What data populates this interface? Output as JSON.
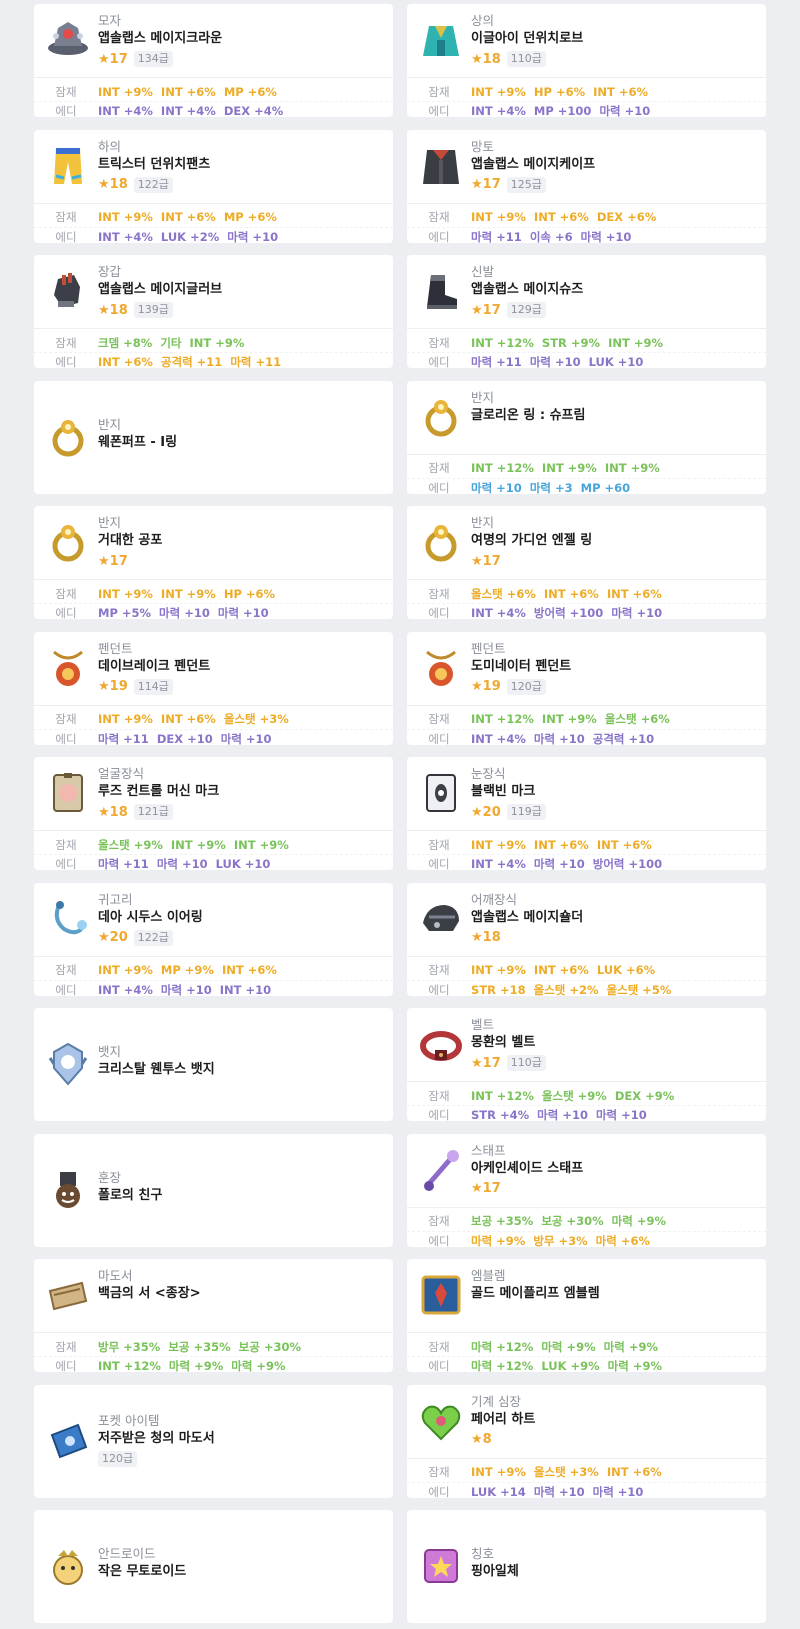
{
  "labels": {
    "potential": "잠재",
    "additional": "에디"
  },
  "colors": {
    "legendary": "#7ac25a",
    "unique": "#eeab26",
    "epic": "#8a74c9",
    "rare": "#48a5db",
    "star": "#f0a830",
    "background": "#eceef2"
  },
  "items": [
    {
      "slot": "모자",
      "name": "앱솔랩스 메이지크라운",
      "stars": "★17",
      "grade": "134급",
      "icon": "hat-icon",
      "pot": {
        "tier": "unique",
        "opts": [
          "INT +9%",
          "INT +6%",
          "MP +6%"
        ]
      },
      "add": {
        "tier": "epic",
        "opts": [
          "INT +4%",
          "INT +4%",
          "DEX +4%"
        ]
      }
    },
    {
      "slot": "상의",
      "name": "이글아이 던위치로브",
      "stars": "★18",
      "grade": "110급",
      "icon": "robe-icon",
      "pot": {
        "tier": "unique",
        "opts": [
          "INT +9%",
          "HP +6%",
          "INT +6%"
        ]
      },
      "add": {
        "tier": "epic",
        "opts": [
          "INT +4%",
          "MP +100",
          "마력 +10"
        ]
      }
    },
    {
      "slot": "하의",
      "name": "트릭스터 던위치팬츠",
      "stars": "★18",
      "grade": "122급",
      "icon": "pants-icon",
      "pot": {
        "tier": "unique",
        "opts": [
          "INT +9%",
          "INT +6%",
          "MP +6%"
        ]
      },
      "add": {
        "tier": "epic",
        "opts": [
          "INT +4%",
          "LUK +2%",
          "마력 +10"
        ]
      }
    },
    {
      "slot": "망토",
      "name": "앱솔랩스 메이지케이프",
      "stars": "★17",
      "grade": "125급",
      "icon": "cape-icon",
      "pot": {
        "tier": "unique",
        "opts": [
          "INT +9%",
          "INT +6%",
          "DEX +6%"
        ]
      },
      "add": {
        "tier": "epic",
        "opts": [
          "마력 +11",
          "이속 +6",
          "마력 +10"
        ]
      }
    },
    {
      "slot": "장갑",
      "name": "앱솔랩스 메이지글러브",
      "stars": "★18",
      "grade": "139급",
      "icon": "glove-icon",
      "pot": {
        "tier": "legendary",
        "opts": [
          "크뎀 +8%",
          "기타",
          "INT +9%"
        ]
      },
      "add": {
        "tier": "unique",
        "opts": [
          "INT +6%",
          "공격력 +11",
          "마력 +11"
        ]
      }
    },
    {
      "slot": "신발",
      "name": "앱솔랩스 메이지슈즈",
      "stars": "★17",
      "grade": "129급",
      "icon": "shoes-icon",
      "pot": {
        "tier": "legendary",
        "opts": [
          "INT +12%",
          "STR +9%",
          "INT +9%"
        ]
      },
      "add": {
        "tier": "epic",
        "opts": [
          "마력 +11",
          "마력 +10",
          "LUK +10"
        ]
      }
    },
    {
      "slot": "반지",
      "name": "웨폰퍼프 - I링",
      "stars": "",
      "grade": "",
      "icon": "ring-icon",
      "pot": null,
      "add": null
    },
    {
      "slot": "반지",
      "name": "글로리온 링 : 슈프림",
      "stars": "",
      "grade": "",
      "icon": "ring-icon",
      "pot": {
        "tier": "legendary",
        "opts": [
          "INT +12%",
          "INT +9%",
          "INT +9%"
        ]
      },
      "add": {
        "tier": "rare",
        "opts": [
          "마력 +10",
          "마력 +3",
          "MP +60"
        ]
      }
    },
    {
      "slot": "반지",
      "name": "거대한 공포",
      "stars": "★17",
      "grade": "",
      "icon": "ring-icon",
      "pot": {
        "tier": "unique",
        "opts": [
          "INT +9%",
          "INT +9%",
          "HP +6%"
        ]
      },
      "add": {
        "tier": "epic",
        "opts": [
          "MP +5%",
          "마력 +10",
          "마력 +10"
        ]
      }
    },
    {
      "slot": "반지",
      "name": "여명의 가디언 엔젤 링",
      "stars": "★17",
      "grade": "",
      "icon": "ring-icon",
      "pot": {
        "tier": "unique",
        "opts": [
          "올스탯 +6%",
          "INT +6%",
          "INT +6%"
        ]
      },
      "add": {
        "tier": "epic",
        "opts": [
          "INT +4%",
          "방어력 +100",
          "마력 +10"
        ]
      }
    },
    {
      "slot": "펜던트",
      "name": "데이브레이크 펜던트",
      "stars": "★19",
      "grade": "114급",
      "icon": "pendant-icon",
      "pot": {
        "tier": "unique",
        "opts": [
          "INT +9%",
          "INT +6%",
          "올스탯 +3%"
        ]
      },
      "add": {
        "tier": "epic",
        "opts": [
          "마력 +11",
          "DEX +10",
          "마력 +10"
        ]
      }
    },
    {
      "slot": "펜던트",
      "name": "도미네이터 펜던트",
      "stars": "★19",
      "grade": "120급",
      "icon": "pendant-icon",
      "pot": {
        "tier": "legendary",
        "opts": [
          "INT +12%",
          "INT +9%",
          "올스탯 +6%"
        ]
      },
      "add": {
        "tier": "epic",
        "opts": [
          "INT +4%",
          "마력 +10",
          "공격력 +10"
        ]
      }
    },
    {
      "slot": "얼굴장식",
      "name": "루즈 컨트롤 머신 마크",
      "stars": "★18",
      "grade": "121급",
      "icon": "face-accessory-icon",
      "pot": {
        "tier": "legendary",
        "opts": [
          "올스탯 +9%",
          "INT +9%",
          "INT +9%"
        ]
      },
      "add": {
        "tier": "epic",
        "opts": [
          "마력 +11",
          "마력 +10",
          "LUK +10"
        ]
      }
    },
    {
      "slot": "눈장식",
      "name": "블랙빈 마크",
      "stars": "★20",
      "grade": "119급",
      "icon": "eye-accessory-icon",
      "pot": {
        "tier": "unique",
        "opts": [
          "INT +9%",
          "INT +6%",
          "INT +6%"
        ]
      },
      "add": {
        "tier": "epic",
        "opts": [
          "INT +4%",
          "마력 +10",
          "방어력 +100"
        ]
      }
    },
    {
      "slot": "귀고리",
      "name": "데아 시두스 이어링",
      "stars": "★20",
      "grade": "122급",
      "icon": "earring-icon",
      "pot": {
        "tier": "unique",
        "opts": [
          "INT +9%",
          "MP +9%",
          "INT +6%"
        ]
      },
      "add": {
        "tier": "epic",
        "opts": [
          "INT +4%",
          "마력 +10",
          "INT +10"
        ]
      }
    },
    {
      "slot": "어깨장식",
      "name": "앱솔랩스 메이지숄더",
      "stars": "★18",
      "grade": "",
      "icon": "shoulder-icon",
      "pot": {
        "tier": "unique",
        "opts": [
          "INT +9%",
          "INT +6%",
          "LUK +6%"
        ]
      },
      "add": {
        "tier": "unique",
        "opts": [
          "STR +18",
          "올스탯 +2%",
          "올스탯 +5%"
        ]
      }
    },
    {
      "slot": "뱃지",
      "name": "크리스탈 웬투스 뱃지",
      "stars": "",
      "grade": "",
      "icon": "badge-icon",
      "pot": null,
      "add": null
    },
    {
      "slot": "벨트",
      "name": "몽환의 벨트",
      "stars": "★17",
      "grade": "110급",
      "icon": "belt-icon",
      "pot": {
        "tier": "legendary",
        "opts": [
          "INT +12%",
          "올스탯 +9%",
          "DEX +9%"
        ]
      },
      "add": {
        "tier": "epic",
        "opts": [
          "STR +4%",
          "마력 +10",
          "마력 +10"
        ]
      }
    },
    {
      "slot": "훈장",
      "name": "폴로의 친구",
      "stars": "",
      "grade": "",
      "icon": "medal-icon",
      "pot": null,
      "add": null
    },
    {
      "slot": "스태프",
      "name": "아케인셰이드 스태프",
      "stars": "★17",
      "grade": "",
      "icon": "staff-icon",
      "pot": {
        "tier": "legendary",
        "opts": [
          "보공 +35%",
          "보공 +30%",
          "마력 +9%"
        ]
      },
      "add": {
        "tier": "unique",
        "opts": [
          "마력 +9%",
          "방무 +3%",
          "마력 +6%"
        ]
      }
    },
    {
      "slot": "마도서",
      "name": "백금의 서 <종장>",
      "stars": "",
      "grade": "",
      "icon": "book-icon",
      "pot": {
        "tier": "legendary",
        "opts": [
          "방무 +35%",
          "보공 +35%",
          "보공 +30%"
        ]
      },
      "add": {
        "tier": "legendary",
        "opts": [
          "INT +12%",
          "마력 +9%",
          "마력 +9%"
        ]
      }
    },
    {
      "slot": "엠블렘",
      "name": "골드 메이플리프 엠블렘",
      "stars": "",
      "grade": "",
      "icon": "emblem-icon",
      "pot": {
        "tier": "legendary",
        "opts": [
          "마력 +12%",
          "마력 +9%",
          "마력 +9%"
        ]
      },
      "add": {
        "tier": "legendary",
        "opts": [
          "마력 +12%",
          "LUK +9%",
          "마력 +9%"
        ]
      }
    },
    {
      "slot": "포켓 아이템",
      "name": "저주받은 청의 마도서",
      "stars": "",
      "grade": "120급",
      "icon": "pocket-book-icon",
      "pot": null,
      "add": null
    },
    {
      "slot": "기계 심장",
      "name": "페어리 하트",
      "stars": "★8",
      "grade": "",
      "icon": "heart-icon",
      "pot": {
        "tier": "unique",
        "opts": [
          "INT +9%",
          "올스탯 +3%",
          "INT +6%"
        ]
      },
      "add": {
        "tier": "epic",
        "opts": [
          "LUK +14",
          "마력 +10",
          "마력 +10"
        ]
      }
    },
    {
      "slot": "안드로이드",
      "name": "작은 무토로이드",
      "stars": "",
      "grade": "",
      "icon": "android-icon",
      "pot": null,
      "add": null
    },
    {
      "slot": "칭호",
      "name": "핑아일체",
      "stars": "",
      "grade": "",
      "icon": "title-icon",
      "pot": null,
      "add": null
    }
  ]
}
